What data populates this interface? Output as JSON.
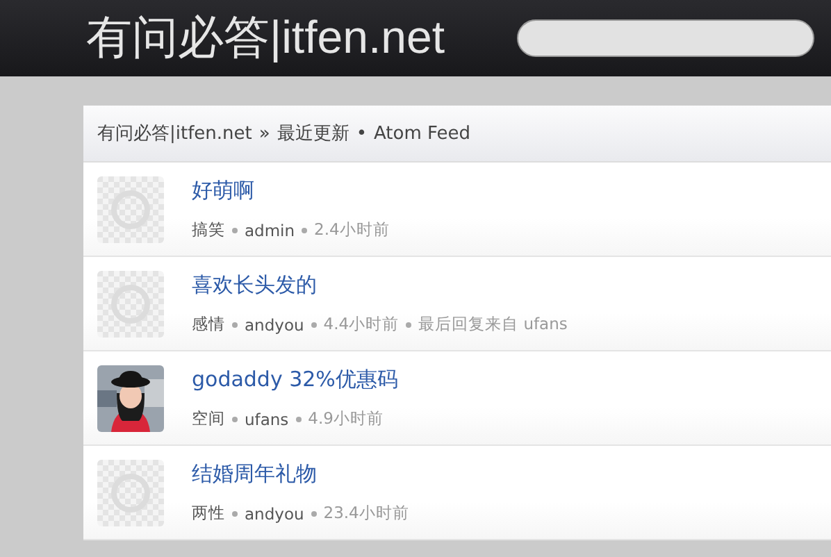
{
  "header": {
    "site_title": "有问必答|itfen.net"
  },
  "breadcrumb": {
    "site": "有问必答|itfen.net",
    "sep1": "»",
    "section": "最近更新",
    "sep2": "•",
    "feed": "Atom Feed"
  },
  "posts": [
    {
      "avatar": {
        "kind": "default"
      },
      "title": "好萌啊",
      "category": "搞笑",
      "author": "admin",
      "time": "2.4小时前"
    },
    {
      "avatar": {
        "kind": "default"
      },
      "title": "喜欢长头发的",
      "category": "感情",
      "author": "andyou",
      "time": "4.4小时前",
      "last_reply": "最后回复来自 ufans"
    },
    {
      "title": "godaddy 32%优惠码",
      "category": "空间",
      "author": "ufans",
      "time": "4.9小时前"
    },
    {
      "avatar": {
        "kind": "default"
      },
      "title": "结婚周年礼物",
      "category": "两性",
      "author": "andyou",
      "time": "23.4小时前"
    }
  ]
}
